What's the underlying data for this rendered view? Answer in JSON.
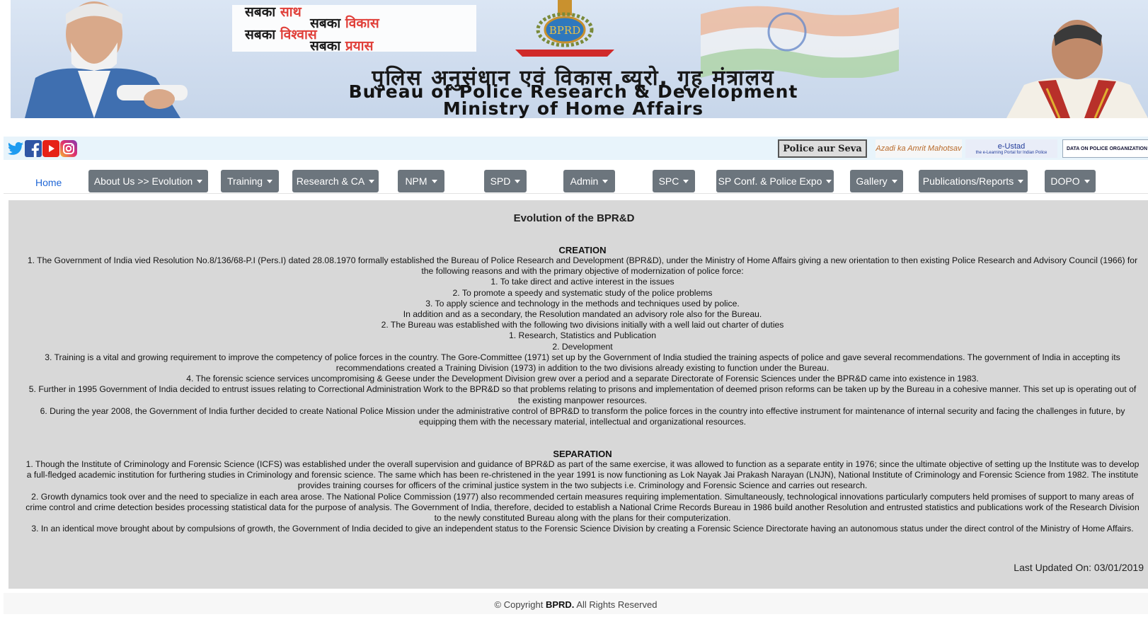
{
  "banner": {
    "slogan": [
      {
        "black": "सबका ",
        "red": "साथ"
      },
      {
        "black": "सबका ",
        "red": "विकास"
      },
      {
        "black": "सबका ",
        "red": "विश्वास"
      },
      {
        "black": "सबका ",
        "red": "प्रयास"
      }
    ],
    "emblem_text": "BPRD",
    "hindi_title": "पुलिस अनुसंधान एवं विकास ब्यूरो, गृह मंत्रालय",
    "english_title_1": "Bureau of Police Research & Development",
    "english_title_2": "Ministry of Home Affairs"
  },
  "social": {
    "icons": [
      "twitter-icon",
      "facebook-icon",
      "youtube-icon",
      "instagram-icon"
    ],
    "logos": {
      "police_aur_seva": "Police aur Seva",
      "azadi": "Azadi ka Amrit Mahotsav",
      "eustad_title": "e-Ustad",
      "eustad_sub": "the e-Learning Portal for Indian Police",
      "dopo": "DATA ON POLICE ORGANIZATION"
    }
  },
  "nav": {
    "home": "Home",
    "items": [
      "About Us >> Evolution",
      "Training",
      "Research & CA",
      "NPM",
      "SPD",
      "Admin",
      "SPC",
      "SP Conf. & Police Expo",
      "Gallery",
      "Publications/Reports",
      "DOPO"
    ]
  },
  "content": {
    "title": "Evolution of the BPR&D",
    "creation_heading": "CREATION",
    "creation_lines": [
      "1. The Government of India vied Resolution No.8/136/68-P.I (Pers.I) dated 28.08.1970 formally established the Bureau of Police Research and Development (BPR&D), under the Ministry of Home Affairs giving a new orientation to then existing Police Research and Advisory Council (1966) for the following reasons and with the primary objective of modernization of police force:",
      "1. To take direct and active interest in the issues",
      "2. To promote a speedy and systematic study of the police problems",
      "3. To apply science and technology in the methods and techniques used by police.",
      "In addition and as a secondary, the Resolution mandated an advisory role also for the Bureau.",
      "2. The Bureau was established with the following two divisions initially with a well laid out charter of duties",
      "1. Research, Statistics and Publication",
      "2. Development",
      "3. Training is a vital and growing requirement to improve the competency of police forces in the country. The Gore-Committee (1971) set up by the Government of India studied the training aspects of police and gave several recommendations. The government of India in accepting its recommendations created a Training Division (1973) in addition to the two divisions already existing to function under the Bureau.",
      "4. The forensic science services uncompromising & Geese under the Development Division grew over a period and a separate Directorate of Forensic Sciences under the BPR&D came into existence in 1983.",
      "5. Further in 1995 Government of India decided to entrust issues relating to Correctional Administration Work to the BPR&D so that problems relating to prisons and implementation of deemed prison reforms can be taken up by the Bureau in a cohesive manner. This set up is operating out of the existing manpower resources.",
      "6. During the year 2008, the Government of India further decided to create National Police Mission under the administrative control of BPR&D to transform the police forces in the country into effective instrument for maintenance of internal security and facing the challenges in future, by equipping them with the necessary material, intellectual and organizational resources."
    ],
    "separation_heading": "SEPARATION",
    "separation_lines": [
      "1. Though the Institute of Criminology and Forensic Science (ICFS) was established under the overall supervision and guidance of BPR&D as part of the same exercise, it was allowed to function as a separate entity in 1976; since the ultimate objective of setting up the Institute was to develop a full-fledged academic institution for furthering studies in Criminology and forensic science. The same which has been re-christened in the year 1991 is now functioning as Lok Nayak Jai Prakash Narayan (LNJN), National Institute of Criminology and Forensic Science from 1982. The institute provides training courses for officers of the criminal justice system in the two subjects i.e. Criminology and Forensic Science and carries out research.",
      "2. Growth dynamics took over and the need to specialize in each area arose. The National Police Commission (1977) also recommended certain measures requiring implementation. Simultaneously, technological innovations particularly computers held promises of support to many areas of crime control and crime detection besides processing statistical data for the purpose of analysis. The Government of India, therefore, decided to establish a National Crime Records Bureau in 1986 build another Resolution and entrusted statistics and publications work of the Research Division to the newly constituted Bureau along with the plans for their computerization.",
      "3. In an identical move brought about by compulsions of growth, the Government of India decided to give an independent status to the Forensic Science Division by creating a Forensic Science Directorate having an autonomous status under the direct control of the Ministry of Home Affairs."
    ],
    "last_updated": "Last Updated On: 03/01/2019"
  },
  "footer": {
    "prefix": "© Copyright ",
    "brand": "BPRD.",
    "suffix": " All Rights Reserved"
  },
  "colors": {
    "nav_button": "#6c757d",
    "home_link": "#1f66d6",
    "content_bg": "#d8d8d8",
    "slogan_red": "#e0403a"
  }
}
